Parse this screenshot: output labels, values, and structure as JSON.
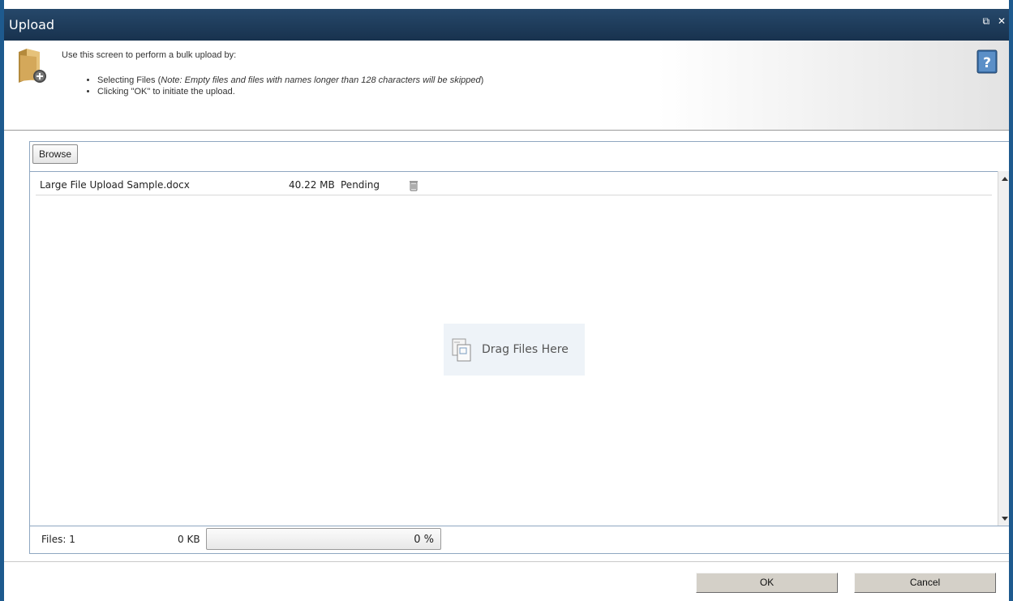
{
  "window": {
    "title": "Upload",
    "restore_glyph": "⧉",
    "close_glyph": "✕"
  },
  "header": {
    "intro": "Use this screen to perform a bulk upload by:",
    "bullets": [
      {
        "lead": "Selecting Files (",
        "note": "Note: Empty files and files with names longer than 128 characters will be skipped",
        "tail": ")"
      },
      {
        "text": "Clicking \"OK\" to initiate the upload."
      }
    ],
    "icons": [
      "folder-add-icon",
      "help-icon"
    ]
  },
  "toolbar": {
    "browse_label": "Browse"
  },
  "files": [
    {
      "name": "Large File Upload Sample.docx",
      "size": "40.22 MB",
      "status": "Pending",
      "icon": "delete-icon"
    }
  ],
  "drop_zone": {
    "label": "Drag Files Here",
    "icon": "drag-files-icon"
  },
  "status": {
    "files_count": "Files: 1",
    "total_size": "0 KB",
    "progress_text": "0 %",
    "progress_fraction": 0
  },
  "buttons": {
    "ok_label": "OK",
    "cancel_label": "Cancel"
  },
  "colors": {
    "titlebar": "#1f3d5c",
    "frame": "#1e5a8e",
    "panel_border": "#8fa7c1"
  }
}
